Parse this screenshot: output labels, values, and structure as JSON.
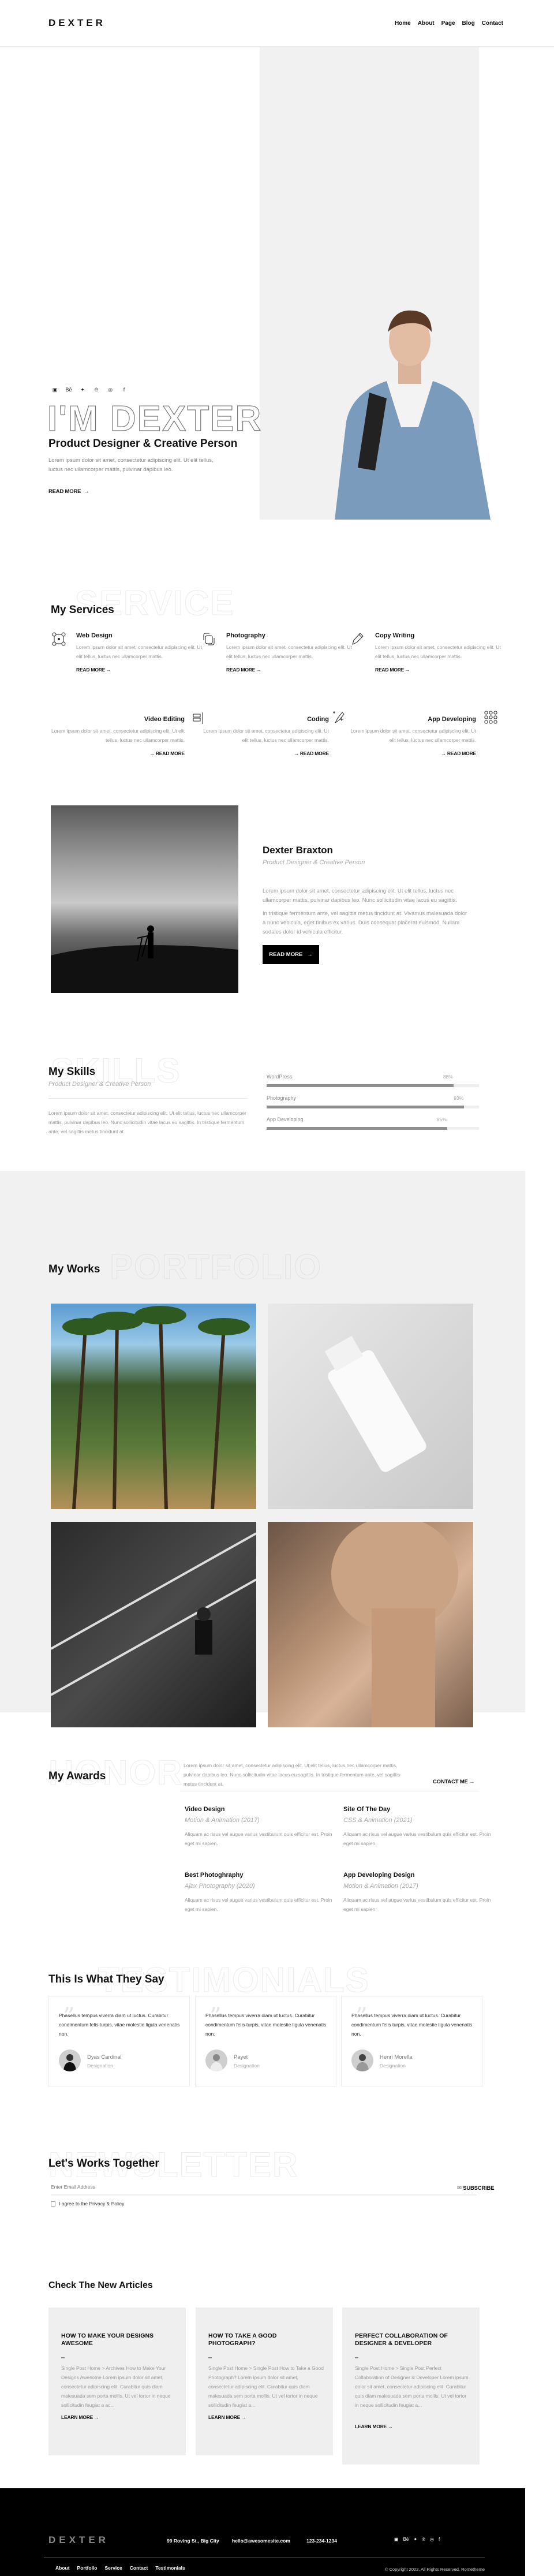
{
  "nav": {
    "logo": "DEXTER",
    "items": [
      "Home",
      "About",
      "Page",
      "Blog",
      "Contact"
    ]
  },
  "hero": {
    "social_icons": [
      "youtube-icon",
      "behance-icon",
      "twitter-icon",
      "pinterest-icon",
      "dribbble-icon",
      "facebook-icon"
    ],
    "big_title": "I'M DEXTER",
    "subtitle": "Product Designer & Creative Person",
    "text": "Lorem ipsum dolor sit amet, consectetur adipiscing elit. Ut elit tellus, luctus nec ullamcorper mattis, pulvinar dapibus leo.",
    "read_more": "READ MORE"
  },
  "services": {
    "ghost": "SERVICE",
    "title": "My Services",
    "items": [
      {
        "title": "Web Design",
        "text": "Lorem ipsum dolor sit amet, consectetur adipiscing elit. Ut elit tellus, luctus nec ullamcorper mattis.",
        "link": "READ MORE",
        "icon": "web-design-icon"
      },
      {
        "title": "Photography",
        "text": "Lorem ipsum dolor sit amet, consectetur adipiscing elit. Ut elit tellus, luctus nec ullamcorper mattis.",
        "link": "READ MORE",
        "icon": "photography-icon"
      },
      {
        "title": "Copy Writing",
        "text": "Lorem ipsum dolor sit amet, consectetur adipiscing elit. Ut elit tellus, luctus nec ullamcorper mattis.",
        "link": "READ MORE",
        "icon": "pencil-icon"
      },
      {
        "title": "Video Editing",
        "text": "Lorem ipsum dolor sit amet, consectetur adipiscing elit. Ut elit tellus, luctus nec ullamcorper mattis.",
        "link": "READ MORE",
        "icon": "video-editing-icon"
      },
      {
        "title": "Coding",
        "text": "Lorem ipsum dolor sit amet, consectetur adipiscing elit. Ut elit tellus, luctus nec ullamcorper mattis.",
        "link": "READ MORE",
        "icon": "coding-icon"
      },
      {
        "title": "App Developing",
        "text": "Lorem ipsum dolor sit amet, consectetur adipiscing elit. Ut elit tellus, luctus nec ullamcorper mattis.",
        "link": "READ MORE",
        "icon": "apps-grid-icon"
      }
    ]
  },
  "about": {
    "name": "Dexter Braxton",
    "role": "Product Designer & Creative Person",
    "p1": "Lorem ipsum dolor sit amet, consectetur adipiscing elit. Ut elit tellus, luctus nec ullamcorper mattis, pulvinar dapibus leo. Nunc sollicitudin vitae lacus eu sagittis.",
    "p2": "In tristique fermentum ante, vel sagittis metus tincidunt at. Vivamus malesuada dolor a nunc vehicula, eget finibus ex varius. Duis consequat placerat euismod. Nullam sodales dolor id vehicula efficitur.",
    "button": "READ MORE"
  },
  "skills": {
    "ghost": "SKILLS",
    "title": "My Skills",
    "subtitle": "Product Designer & Creative Person",
    "text": "Lorem ipsum dolor sit amet, consectetur adipiscing elit. Ut elit tellus, luctus nec ullamcorper mattis, pulvinar dapibus leo. Nunc sollicitudin vitae lacus eu sagittis. In tristique fermentum ante, vel sagittis metus tincidunt at.",
    "items": [
      {
        "label": "WordPress",
        "percent": 88,
        "percent_label": "88%"
      },
      {
        "label": "Photography",
        "percent": 93,
        "percent_label": "93%"
      },
      {
        "label": "App Developing",
        "percent": 85,
        "percent_label": "85%"
      }
    ]
  },
  "works": {
    "ghost": "PORTFOLIO",
    "title": "My Works",
    "images": [
      "palm-trees-photo",
      "white-bottle-photo",
      "man-on-road-photo",
      "woman-shadow-photo"
    ]
  },
  "awards": {
    "ghost": "HONOR",
    "title": "My Awards",
    "text": "Lorem ipsum dolor sit amet, consectetur adipiscing elit. Ut elit tellus, luctus nec ullamcorper mattis, pulvinar dapibus leo. Nunc sollicitudin vitae lacus eu sagittis. In tristique fermentum ante, vel sagittis metus tincidunt at.",
    "contact": "CONTACT ME",
    "items": [
      {
        "title": "Video Design",
        "sub": "Motion & Animation (2017)",
        "text": "Aliquam ac risus vel augue varius vestibulum quis efficitur est. Proin eget mi sapien."
      },
      {
        "title": "Site Of The Day",
        "sub": "CSS & Animation (2021)",
        "text": "Aliquam ac risus vel augue varius vestibulum quis efficitur est. Proin eget mi sapien."
      },
      {
        "title": "Best Photoghraphy",
        "sub": "Ajax Photography (2020)",
        "text": "Aliquam ac risus vel augue varius vestibulum quis efficitur est. Proin eget mi sapien."
      },
      {
        "title": "App Developing Design",
        "sub": "Motion & Animation (2017)",
        "text": "Aliquam ac risus vel augue varius vestibulum quis efficitur est. Proin eget mi sapien."
      }
    ]
  },
  "testimonials": {
    "ghost": "TESTIMONIALS",
    "title": "This Is What They Say",
    "items": [
      {
        "text": "Phasellus tempus viverra diam ut luctus. Curabitur condimentum felis turpis, vitae molestie ligula venenatis non.",
        "name": "Dyas Cardinal",
        "designation": "Designation"
      },
      {
        "text": "Phasellus tempus viverra diam ut luctus. Curabitur condimentum felis turpis, vitae molestie ligula venenatis non.",
        "name": "Payet",
        "designation": "Designation"
      },
      {
        "text": "Phasellus tempus viverra diam ut luctus. Curabitur condimentum felis turpis, vitae molestie ligula venenatis non.",
        "name": "Henri Morella",
        "designation": "Designation"
      }
    ]
  },
  "newsletter": {
    "ghost": "NEWSLETTER",
    "title": "Let's Works Together",
    "placeholder": "Enter Email Address",
    "subscribe": "SUBSCRIBE",
    "agree": "I agree to the Privacy & Policy"
  },
  "articles": {
    "title": "Check The New Articles",
    "items": [
      {
        "title": "HOW TO MAKE YOUR DESIGNS AWESOME",
        "text": "Single Post Home > Archives How to Make Your Designs Awesome Lorem ipsum dolor sit amet, consectetur adipiscing elit. Curabitur quis diam malesuada sem porta mollis. Ut vel tortor in neque sollicitudin feugiat a ac...",
        "link": "LEARN MORE"
      },
      {
        "title": "HOW TO TAKE A GOOD PHOTOGRAPH?",
        "text": "Single Post Home > Single Post How to Take a Good Photograph? Lorem ipsum dolor sit amet, consectetur adipiscing elit. Curabitur quis diam malesuada sem porta mollis. Ut vel tortor in neque sollicitudin feugiat a...",
        "link": "LEARN MORE"
      },
      {
        "title": "PERFECT COLLABORATION OF DESIGNER & DEVELOPER",
        "text": "Single Post Home > Single Post Perfect Collaboration of Designer & Developer Lorem ipsum dolor sit amet, consectetur adipiscing elit. Curabitur quis diam malesuada sem porta mollis. Ut vel tortor in neque sollicitudin feugiat a...",
        "link": "LEARN MORE"
      }
    ]
  },
  "footer": {
    "logo": "DEXTER",
    "address": "99 Roving St., Big City",
    "email": "hello@awesomesite.com",
    "phone": "123-234-1234",
    "links": [
      "About",
      "Portfolio",
      "Service",
      "Contact",
      "Testimonials"
    ],
    "copyright": "© Copyright 2022. All Rights Reserved. Rometheme"
  }
}
